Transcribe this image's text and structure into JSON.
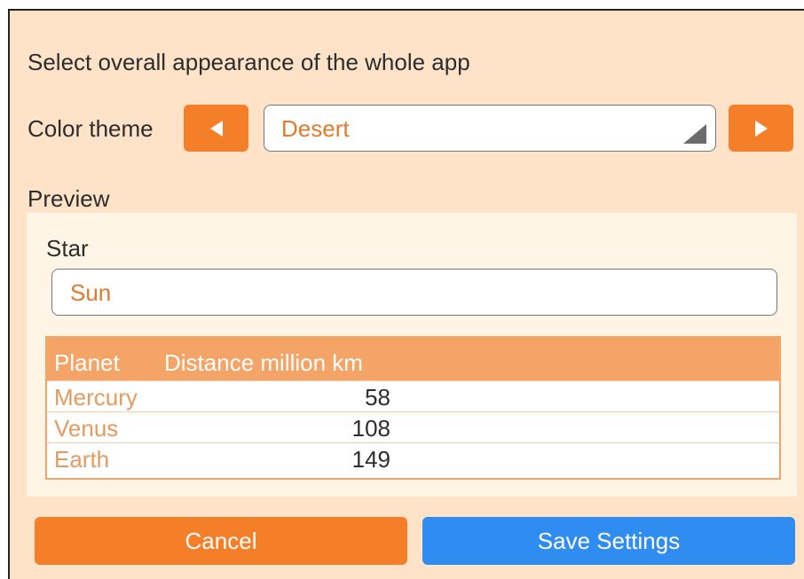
{
  "heading": "Select overall appearance of the whole app",
  "theme": {
    "label": "Color theme",
    "selected": "Desert",
    "prev_icon": "triangle-left-icon",
    "next_icon": "triangle-right-icon"
  },
  "preview": {
    "label": "Preview",
    "star_label": "Star",
    "star_value": "Sun",
    "table": {
      "columns": [
        "Planet",
        "Distance million km"
      ],
      "rows": [
        {
          "planet": "Mercury",
          "distance": "58"
        },
        {
          "planet": "Venus",
          "distance": "108"
        },
        {
          "planet": "Earth",
          "distance": "149"
        }
      ]
    }
  },
  "buttons": {
    "cancel": "Cancel",
    "save": "Save Settings"
  },
  "colors": {
    "accent": "#f57f28",
    "panel_bg": "#fee3c9",
    "save_blue": "#2f8cf0"
  }
}
